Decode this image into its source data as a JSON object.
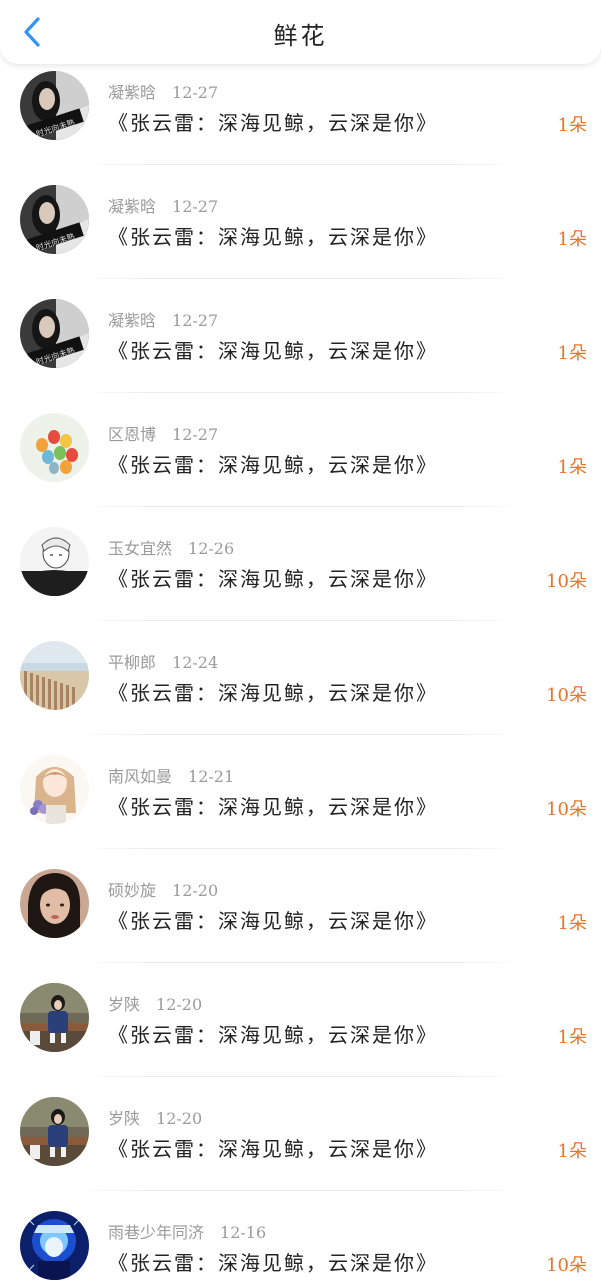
{
  "header": {
    "title": "鲜花",
    "back_icon": "chevron-left-icon",
    "accent_color": "#2f95f0"
  },
  "count_color": "#e8732a",
  "list": {
    "items": [
      {
        "user": "凝紫晗",
        "date": "12-27",
        "work": "《张云雷：深海见鲸，云深是你》",
        "count": "1朵",
        "avatar": "dark-portrait"
      },
      {
        "user": "凝紫晗",
        "date": "12-27",
        "work": "《张云雷：深海见鲸，云深是你》",
        "count": "1朵",
        "avatar": "dark-portrait"
      },
      {
        "user": "凝紫晗",
        "date": "12-27",
        "work": "《张云雷：深海见鲸，云深是你》",
        "count": "1朵",
        "avatar": "dark-portrait"
      },
      {
        "user": "区恩博",
        "date": "12-27",
        "work": "《张云雷：深海见鲸，云深是你》",
        "count": "1朵",
        "avatar": "balloons"
      },
      {
        "user": "玉女宜然",
        "date": "12-26",
        "work": "《张云雷：深海见鲸，云深是你》",
        "count": "10朵",
        "avatar": "anime-boy"
      },
      {
        "user": "平柳郎",
        "date": "12-24",
        "work": "《张云雷：深海见鲸，云深是你》",
        "count": "10朵",
        "avatar": "beach-fence"
      },
      {
        "user": "南风如曼",
        "date": "12-21",
        "work": "《张云雷：深海见鲸，云深是你》",
        "count": "10朵",
        "avatar": "illustrated-girl"
      },
      {
        "user": "硕妙旋",
        "date": "12-20",
        "work": "《张云雷：深海见鲸，云深是你》",
        "count": "1朵",
        "avatar": "girl-portrait"
      },
      {
        "user": "岁陕",
        "date": "12-20",
        "work": "《张云雷：深海见鲸，云深是你》",
        "count": "1朵",
        "avatar": "girl-bench"
      },
      {
        "user": "岁陕",
        "date": "12-20",
        "work": "《张云雷：深海见鲸，云深是你》",
        "count": "1朵",
        "avatar": "girl-bench"
      },
      {
        "user": "雨巷少年同济",
        "date": "12-16",
        "work": "《张云雷：深海见鲸，云深是你》",
        "count": "10朵",
        "avatar": "blue-neon"
      }
    ]
  }
}
